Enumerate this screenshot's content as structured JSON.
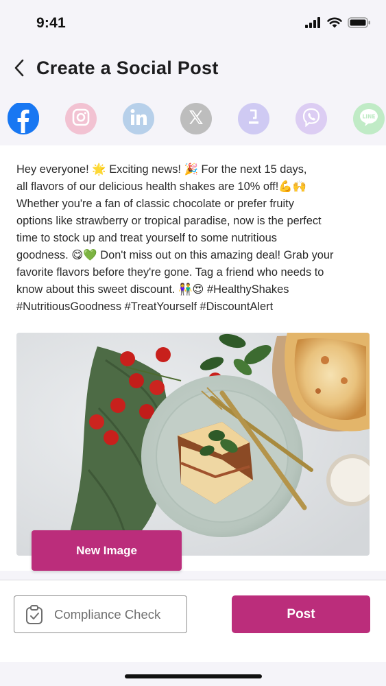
{
  "status_bar": {
    "time": "9:41",
    "icons": [
      "cellular-signal-icon",
      "wifi-icon",
      "battery-icon"
    ]
  },
  "header": {
    "title": "Create a Social Post",
    "back_icon": "chevron-left-icon"
  },
  "social_platforms": [
    {
      "name": "facebook",
      "icon": "facebook-icon",
      "color": "#1877f2",
      "selected": true
    },
    {
      "name": "instagram",
      "icon": "instagram-icon",
      "color": "#e9a9bf",
      "selected": false
    },
    {
      "name": "linkedin",
      "icon": "linkedin-icon",
      "color": "#a9c6e3",
      "selected": false
    },
    {
      "name": "x",
      "icon": "x-icon",
      "color": "#b9b9b9",
      "selected": false
    },
    {
      "name": "fifth-platform",
      "icon": "download-icon",
      "color": "#c6c2f0",
      "selected": false
    },
    {
      "name": "viber",
      "icon": "viber-icon",
      "color": "#d3c3f0",
      "selected": false
    },
    {
      "name": "line",
      "icon": "line-icon",
      "color": "#b7e8bf",
      "selected": false
    }
  ],
  "post": {
    "text": "Hey everyone! 🌟 Exciting news! 🎉 For the next 15 days,\nall flavors of our delicious health shakes are 10% off!💪🙌\nWhether you're a fan of classic chocolate or prefer fruity\noptions like strawberry or tropical paradise, now is the perfect\ntime to stock up and treat yourself to some nutritious\ngoodness. 😋💚 Don't miss out on this amazing deal! Grab your\nfavorite flavors before they're gone. Tag a friend who needs to\nknow about this sweet discount.  👫😍 #HealthyShakes\n#NutritiousGoodness #TreatYourself #DiscountAlert",
    "image_icon": "lasagna-photo"
  },
  "actions": {
    "new_image_label": "New Image",
    "compliance_label": "Compliance Check",
    "compliance_icon": "clipboard-check-icon",
    "post_label": "Post"
  },
  "colors": {
    "accent": "#bb2d7b",
    "facebook": "#1877f2"
  }
}
